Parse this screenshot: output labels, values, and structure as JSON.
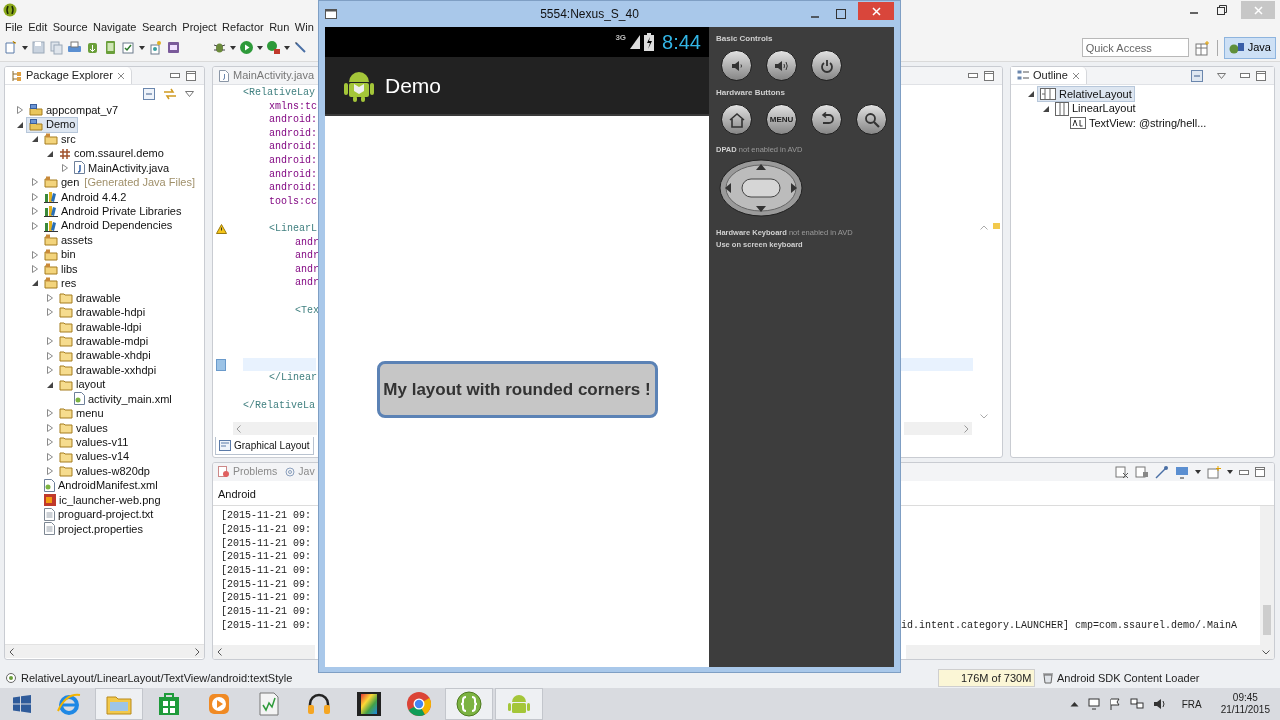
{
  "eclipse": {
    "menu": [
      "File",
      "Edit",
      "Source",
      "Navigate",
      "Search",
      "Project",
      "Refactor",
      "Run",
      "Win"
    ],
    "quick_access": {
      "placeholder": "Quick Access"
    },
    "perspective": {
      "label": "Java",
      "selected": true
    },
    "package_explorer": {
      "title": "Package Explorer",
      "tree": [
        {
          "label": "appcompat_v7",
          "kind": "project",
          "expanded": false,
          "selected": false
        },
        {
          "label": "Demo",
          "kind": "project",
          "expanded": true,
          "selected": true,
          "children": [
            {
              "label": "src",
              "kind": "source-folder",
              "expanded": true,
              "selected": false,
              "children": [
                {
                  "label": "com.ssaurel.demo",
                  "kind": "package",
                  "expanded": true,
                  "selected": false,
                  "children": [
                    {
                      "label": "MainActivity.java",
                      "kind": "java-file",
                      "expanded": false,
                      "selected": false
                    }
                  ]
                }
              ]
            },
            {
              "label": "gen",
              "decoration": "[Generated Java Files]",
              "kind": "source-folder",
              "expanded": false,
              "selected": false
            },
            {
              "label": "Android 4.4.2",
              "kind": "library",
              "expanded": false,
              "selected": false
            },
            {
              "label": "Android Private Libraries",
              "kind": "library",
              "expanded": false,
              "selected": false
            },
            {
              "label": "Android Dependencies",
              "kind": "library",
              "expanded": false,
              "selected": false
            },
            {
              "label": "assets",
              "kind": "source-folder",
              "selected": false
            },
            {
              "label": "bin",
              "kind": "source-folder",
              "expanded": false,
              "selected": false
            },
            {
              "label": "libs",
              "kind": "source-folder",
              "expanded": false,
              "selected": false
            },
            {
              "label": "res",
              "kind": "source-folder",
              "expanded": true,
              "selected": false,
              "children": [
                {
                  "label": "drawable",
                  "kind": "folder",
                  "expanded": false,
                  "selected": false
                },
                {
                  "label": "drawable-hdpi",
                  "kind": "folder",
                  "expanded": false,
                  "selected": false
                },
                {
                  "label": "drawable-ldpi",
                  "kind": "folder",
                  "selected": false
                },
                {
                  "label": "drawable-mdpi",
                  "kind": "folder",
                  "expanded": false,
                  "selected": false
                },
                {
                  "label": "drawable-xhdpi",
                  "kind": "folder",
                  "expanded": false,
                  "selected": false
                },
                {
                  "label": "drawable-xxhdpi",
                  "kind": "folder",
                  "expanded": false,
                  "selected": false
                },
                {
                  "label": "layout",
                  "kind": "folder",
                  "expanded": true,
                  "selected": false,
                  "children": [
                    {
                      "label": "activity_main.xml",
                      "kind": "xml-file",
                      "selected": false
                    }
                  ]
                },
                {
                  "label": "menu",
                  "kind": "folder",
                  "expanded": false,
                  "selected": false
                },
                {
                  "label": "values",
                  "kind": "folder",
                  "expanded": false,
                  "selected": false
                },
                {
                  "label": "values-v11",
                  "kind": "folder",
                  "expanded": false,
                  "selected": false
                },
                {
                  "label": "values-v14",
                  "kind": "folder",
                  "expanded": false,
                  "selected": false
                },
                {
                  "label": "values-w820dp",
                  "kind": "folder",
                  "expanded": false,
                  "selected": false
                }
              ]
            },
            {
              "label": "AndroidManifest.xml",
              "kind": "xml-file",
              "selected": false
            },
            {
              "label": "ic_launcher-web.png",
              "kind": "image-file",
              "selected": false
            },
            {
              "label": "proguard-project.txt",
              "kind": "text-file",
              "selected": false
            },
            {
              "label": "project.properties",
              "kind": "text-file",
              "selected": false
            }
          ]
        }
      ]
    },
    "editor": {
      "tab": "MainActivity.java",
      "bottom_tab": "Graphical Layout",
      "lines": [
        {
          "kind": "tag",
          "text": "<RelativeLay",
          "children": [
            {
              "kind": "attr",
              "text": "xmlns:tc"
            },
            {
              "kind": "attr",
              "text": "android:"
            },
            {
              "kind": "attr",
              "text": "android:"
            },
            {
              "kind": "attr",
              "text": "android:"
            },
            {
              "kind": "attr",
              "text": "android:"
            },
            {
              "kind": "attr",
              "text": "android:"
            },
            {
              "kind": "attr",
              "text": "android:"
            },
            {
              "kind": "attr",
              "text": "tools:cc"
            },
            {
              "kind": "blank"
            },
            {
              "kind": "tag",
              "text": "<LinearL",
              "warning": true,
              "children": [
                {
                  "kind": "attr",
                  "text": "andr"
                },
                {
                  "kind": "attr",
                  "text": "andr"
                },
                {
                  "kind": "attr",
                  "text": "andr"
                },
                {
                  "kind": "attr",
                  "text": "andr"
                },
                {
                  "kind": "blank"
                },
                {
                  "kind": "tag",
                  "text": "<Tex"
                },
                {
                  "kind": "blank"
                },
                {
                  "kind": "blank"
                },
                {
                  "kind": "blank"
                },
                {
                  "kind": "blank",
                  "current": true
                }
              ]
            },
            {
              "kind": "tag",
              "text": "</Linear"
            },
            {
              "kind": "blank"
            }
          ]
        },
        {
          "kind": "tag",
          "text": "</RelativeLa"
        }
      ]
    },
    "outline": {
      "title": "Outline",
      "tree": [
        {
          "label": "RelativeLayout",
          "kind": "relative-layout",
          "expanded": true,
          "selected": true,
          "children": [
            {
              "label": "LinearLayout",
              "kind": "linear-layout",
              "expanded": true,
              "selected": false,
              "children": [
                {
                  "label": "TextView: @string/hell...",
                  "kind": "text-view",
                  "selected": false
                }
              ]
            }
          ]
        }
      ]
    },
    "console": {
      "tabs": [
        "Problems",
        "Jav"
      ],
      "title": "Android",
      "lines": [
        {
          "text": "[2015-11-21 09:"
        },
        {
          "text": "[2015-11-21 09:"
        },
        {
          "text": "[2015-11-21 09:"
        },
        {
          "text": "[2015-11-21 09:"
        },
        {
          "text": "[2015-11-21 09:"
        },
        {
          "text": "[2015-11-21 09:"
        },
        {
          "text": "[2015-11-21 09:"
        },
        {
          "text": "[2015-11-21 09:"
        },
        {
          "text": "[2015-11-21 09:",
          "tail": "id.intent.category.LAUNCHER] cmp=com.ssaurel.demo/.MainA"
        }
      ]
    },
    "status": "RelativeLayout/LinearLayout/TextView/android:textStyle",
    "memory": "176M of 730M",
    "job": "Android SDK Content Loader"
  },
  "emulator": {
    "title": "5554:Nexus_S_40",
    "phone": {
      "network": "3G",
      "time": "8:44",
      "app_title": "Demo",
      "button_text": "My layout with rounded corners !"
    },
    "controls": [
      {
        "title": "Basic Controls",
        "buttons": [
          {
            "kind": "volume-down"
          },
          {
            "kind": "volume-up"
          },
          {
            "kind": "power"
          }
        ]
      },
      {
        "title": "Hardware Buttons",
        "buttons": [
          {
            "kind": "home"
          },
          {
            "kind": "menu",
            "label": "MENU"
          },
          {
            "kind": "back"
          },
          {
            "kind": "search"
          }
        ]
      }
    ],
    "dpad_note": "**DPAD** not enabled in AVD",
    "keyboard_note": "**Hardware Keyboard** not enabled in AVD",
    "keyboard_hint": "Use on screen keyboard"
  },
  "taskbar": {
    "apps": [
      {
        "kind": "browser",
        "running": false
      },
      {
        "kind": "files",
        "running": true
      },
      {
        "kind": "store",
        "running": false
      },
      {
        "kind": "media",
        "running": false
      },
      {
        "kind": "notepad",
        "running": false
      },
      {
        "kind": "headphones",
        "running": false
      },
      {
        "kind": "film",
        "running": false
      },
      {
        "kind": "chrome",
        "running": false
      },
      {
        "kind": "braces",
        "running": true
      },
      {
        "kind": "android",
        "running": true
      }
    ],
    "language": "FRA",
    "time": "09:45",
    "date": "21/11/2015"
  }
}
